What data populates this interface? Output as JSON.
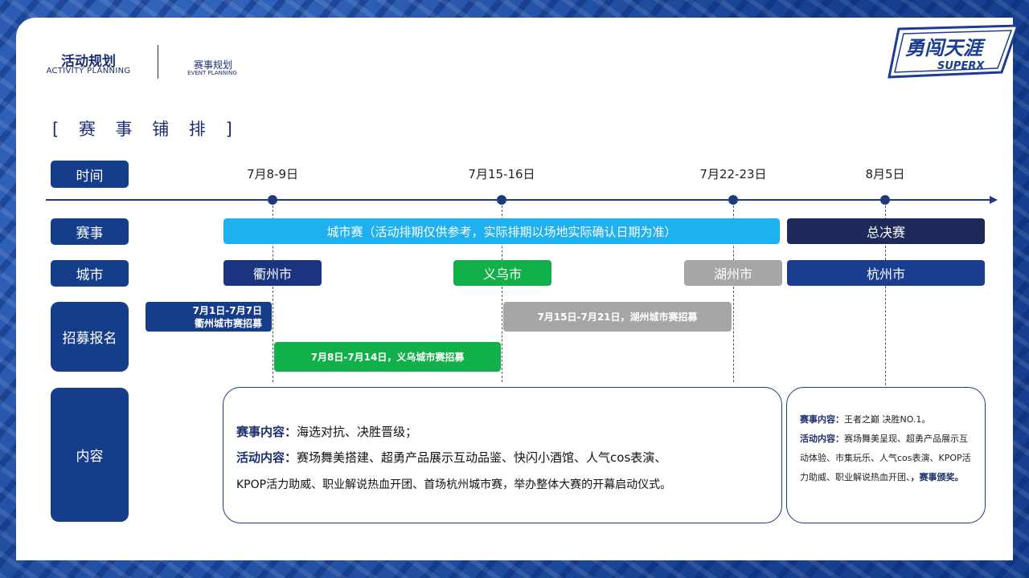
{
  "header": {
    "title": "活动规划",
    "subtitle": "ACTIVITY PLANNING",
    "section": "赛事规划",
    "section_sub": "EVENT PLANNING"
  },
  "logo": {
    "line1": "勇闯天涯",
    "line2": "SUPERX"
  },
  "page_title": "[ 赛 事 铺 排 ]",
  "rows": {
    "time": "时间",
    "event": "赛事",
    "city": "城市",
    "recruit": "招募报名",
    "content": "内容"
  },
  "dates": [
    "7月8-9日",
    "7月15-16日",
    "7月22-23日",
    "8月5日"
  ],
  "events": {
    "city_race": "城市赛（活动排期仅供参考，实际排期以场地实际确认日期为准）",
    "final": "总决赛"
  },
  "cities": {
    "quzhou": "衢州市",
    "yiwu": "义乌市",
    "huzhou": "湖州市",
    "hangzhou": "杭州市"
  },
  "recruit": {
    "quzhou_line1": "7月1日-7月7日",
    "quzhou_line2": "衢州城市赛招募",
    "huzhou": "7月15日-7月21日，湖州城市赛招募",
    "yiwu": "7月8日-7月14日，义乌城市赛招募"
  },
  "content_city": {
    "event_label": "赛事内容：",
    "event_text": "海选对抗、决胜晋级；",
    "activity_label": "活动内容：",
    "activity_text": "赛场舞美搭建、超勇产品展示互动品鉴、快闪小酒馆、人气cos表演、",
    "activity_text2": "KPOP活力助威、职业解说热血开团、首场杭州城市赛，举办整体大赛的开幕启动仪式。"
  },
  "content_final": {
    "event_label": "赛事内容：",
    "event_text": "王者之巅 决胜NO.1。",
    "activity_label": "活动内容：",
    "activity_text": "赛场舞美呈现、超勇产品展示互动体验、市集玩乐、人气cos表演、KPOP活力助威、职业解说热血开团、",
    "award": "，赛事颁奖。"
  },
  "colors": {
    "navy": "#163d8a",
    "light_blue": "#1fb0ef",
    "dark_navy": "#1f2a5a",
    "green": "#12b04a",
    "gray": "#a6a6a6",
    "blue_city": "#1a3d8f"
  }
}
